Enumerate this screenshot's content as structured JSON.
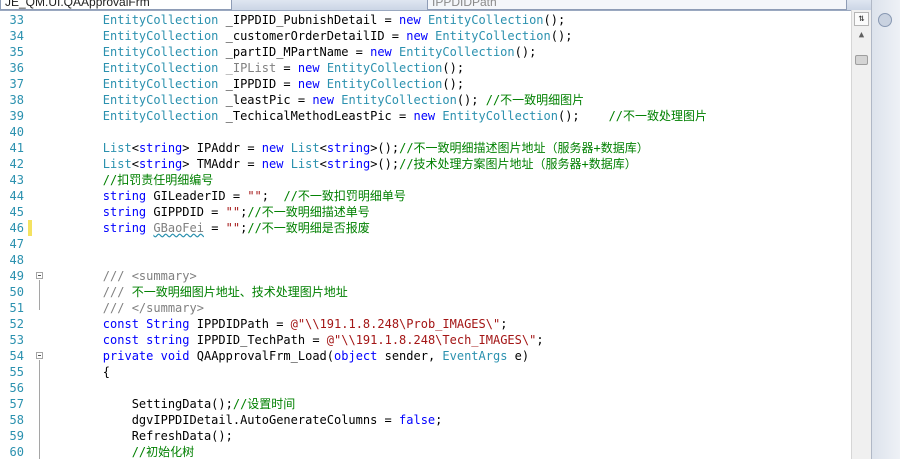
{
  "window": {
    "file_tab": "JE_QM.UI.QAApprovalFrm",
    "member_dropdown": "IPPDIDPath"
  },
  "editor": {
    "lines": [
      {
        "n": "33",
        "segs": [
          [
            "",
            "        "
          ],
          [
            "ty",
            "EntityCollection"
          ],
          [
            "",
            " _IPPDID_PubnishDetail = "
          ],
          [
            "kw",
            "new"
          ],
          [
            "",
            " "
          ],
          [
            "ty",
            "EntityCollection"
          ],
          [
            "",
            "();"
          ]
        ]
      },
      {
        "n": "34",
        "segs": [
          [
            "",
            "        "
          ],
          [
            "ty",
            "EntityCollection"
          ],
          [
            "",
            " _customerOrderDetailID = "
          ],
          [
            "kw",
            "new"
          ],
          [
            "",
            " "
          ],
          [
            "ty",
            "EntityCollection"
          ],
          [
            "",
            "();"
          ]
        ]
      },
      {
        "n": "35",
        "segs": [
          [
            "",
            "        "
          ],
          [
            "ty",
            "EntityCollection"
          ],
          [
            "",
            " _partID_MPartName = "
          ],
          [
            "kw",
            "new"
          ],
          [
            "",
            " "
          ],
          [
            "ty",
            "EntityCollection"
          ],
          [
            "",
            "();"
          ]
        ]
      },
      {
        "n": "36",
        "segs": [
          [
            "",
            "        "
          ],
          [
            "ty",
            "EntityCollection"
          ],
          [
            "",
            " "
          ],
          [
            "gray",
            "_IPList"
          ],
          [
            "",
            " = "
          ],
          [
            "kw",
            "new"
          ],
          [
            "",
            " "
          ],
          [
            "ty",
            "EntityCollection"
          ],
          [
            "",
            "();"
          ]
        ]
      },
      {
        "n": "37",
        "segs": [
          [
            "",
            "        "
          ],
          [
            "ty",
            "EntityCollection"
          ],
          [
            "",
            " _IPPDID = "
          ],
          [
            "kw",
            "new"
          ],
          [
            "",
            " "
          ],
          [
            "ty",
            "EntityCollection"
          ],
          [
            "",
            "();"
          ]
        ]
      },
      {
        "n": "38",
        "segs": [
          [
            "",
            "        "
          ],
          [
            "ty",
            "EntityCollection"
          ],
          [
            "",
            " _leastPic = "
          ],
          [
            "kw",
            "new"
          ],
          [
            "",
            " "
          ],
          [
            "ty",
            "EntityCollection"
          ],
          [
            "",
            "(); "
          ],
          [
            "cm",
            "//不一致明细图片"
          ]
        ]
      },
      {
        "n": "39",
        "segs": [
          [
            "",
            "        "
          ],
          [
            "ty",
            "EntityCollection"
          ],
          [
            "",
            " _TechicalMethodLeastPic = "
          ],
          [
            "kw",
            "new"
          ],
          [
            "",
            " "
          ],
          [
            "ty",
            "EntityCollection"
          ],
          [
            "",
            "();    "
          ],
          [
            "cm",
            "//不一致处理图片"
          ]
        ]
      },
      {
        "n": "40",
        "segs": []
      },
      {
        "n": "41",
        "segs": [
          [
            "",
            "        "
          ],
          [
            "ty",
            "List"
          ],
          [
            "",
            "<"
          ],
          [
            "kw",
            "string"
          ],
          [
            "",
            "> IPAddr = "
          ],
          [
            "kw",
            "new"
          ],
          [
            "",
            " "
          ],
          [
            "ty",
            "List"
          ],
          [
            "",
            "<"
          ],
          [
            "kw",
            "string"
          ],
          [
            "",
            ">();"
          ],
          [
            "cm",
            "//不一致明细描述图片地址（服务器+数据库）"
          ]
        ]
      },
      {
        "n": "42",
        "segs": [
          [
            "",
            "        "
          ],
          [
            "ty",
            "List"
          ],
          [
            "",
            "<"
          ],
          [
            "kw",
            "string"
          ],
          [
            "",
            "> TMAddr = "
          ],
          [
            "kw",
            "new"
          ],
          [
            "",
            " "
          ],
          [
            "ty",
            "List"
          ],
          [
            "",
            "<"
          ],
          [
            "kw",
            "string"
          ],
          [
            "",
            ">();"
          ],
          [
            "cm",
            "//技术处理方案图片地址（服务器+数据库）"
          ]
        ]
      },
      {
        "n": "43",
        "segs": [
          [
            "",
            "        "
          ],
          [
            "cm",
            "//扣罚责任明细编号"
          ]
        ]
      },
      {
        "n": "44",
        "segs": [
          [
            "",
            "        "
          ],
          [
            "kw",
            "string"
          ],
          [
            "",
            " GILeaderID = "
          ],
          [
            "str",
            "\"\""
          ],
          [
            "",
            ";  "
          ],
          [
            "cm",
            "//不一致扣罚明细单号"
          ]
        ]
      },
      {
        "n": "45",
        "segs": [
          [
            "",
            "        "
          ],
          [
            "kw",
            "string"
          ],
          [
            "",
            " GIPPDID = "
          ],
          [
            "str",
            "\"\""
          ],
          [
            "",
            ";"
          ],
          [
            "cm",
            "//不一致明细描述单号"
          ]
        ]
      },
      {
        "n": "46",
        "segs": [
          [
            "",
            "        "
          ],
          [
            "kw",
            "string"
          ],
          [
            "",
            " "
          ],
          [
            "gsq",
            "GBaoFei"
          ],
          [
            "",
            " = "
          ],
          [
            "str",
            "\"\""
          ],
          [
            "",
            ";"
          ],
          [
            "cm",
            "//不一致明细是否报废"
          ]
        ]
      },
      {
        "n": "47",
        "segs": []
      },
      {
        "n": "48",
        "segs": []
      },
      {
        "n": "49",
        "segs": [
          [
            "",
            "        "
          ],
          [
            "gray",
            "/// <summary>"
          ]
        ]
      },
      {
        "n": "50",
        "segs": [
          [
            "",
            "        "
          ],
          [
            "gray",
            "///"
          ],
          [
            "cm",
            " 不一致明细图片地址、技术处理图片地址"
          ]
        ]
      },
      {
        "n": "51",
        "segs": [
          [
            "",
            "        "
          ],
          [
            "gray",
            "/// </summary>"
          ]
        ]
      },
      {
        "n": "52",
        "segs": [
          [
            "",
            "        "
          ],
          [
            "kw",
            "const"
          ],
          [
            "",
            " "
          ],
          [
            "kw",
            "String"
          ],
          [
            "",
            " IPPDIDPath = "
          ],
          [
            "str",
            "@\"\\\\191.1.8.248\\Prob_IMAGES\\\""
          ],
          [
            "",
            ";"
          ]
        ]
      },
      {
        "n": "53",
        "segs": [
          [
            "",
            "        "
          ],
          [
            "kw",
            "const"
          ],
          [
            "",
            " "
          ],
          [
            "kw",
            "string"
          ],
          [
            "",
            " IPPDID_TechPath = "
          ],
          [
            "str",
            "@\"\\\\191.1.8.248\\Tech_IMAGES\\\""
          ],
          [
            "",
            ";"
          ]
        ]
      },
      {
        "n": "54",
        "segs": [
          [
            "",
            "        "
          ],
          [
            "kw",
            "private"
          ],
          [
            "",
            " "
          ],
          [
            "kw",
            "void"
          ],
          [
            "",
            " QAApprovalFrm_Load("
          ],
          [
            "kw",
            "object"
          ],
          [
            "",
            " sender, "
          ],
          [
            "ty",
            "EventArgs"
          ],
          [
            "",
            " e)"
          ]
        ]
      },
      {
        "n": "55",
        "segs": [
          [
            "",
            "        {"
          ]
        ]
      },
      {
        "n": "56",
        "segs": []
      },
      {
        "n": "57",
        "segs": [
          [
            "",
            "            SettingData();"
          ],
          [
            "cm",
            "//设置时间"
          ]
        ]
      },
      {
        "n": "58",
        "segs": [
          [
            "",
            "            dgvIPPDIDetail.AutoGenerateColumns = "
          ],
          [
            "kw",
            "false"
          ],
          [
            "",
            ";"
          ]
        ]
      },
      {
        "n": "59",
        "segs": [
          [
            "",
            "            RefreshData();"
          ]
        ]
      },
      {
        "n": "60",
        "segs": [
          [
            "",
            "            "
          ],
          [
            "cm",
            "//初始化树"
          ]
        ]
      }
    ]
  },
  "scrollbar": {
    "split_glyph": "⇅",
    "up_arrow": "▲"
  },
  "colors": {
    "keyword": "#0000ff",
    "type": "#2b91af",
    "string": "#a31515",
    "comment": "#008000",
    "line_number": "#2b91af",
    "change_marker": "#f4e261"
  }
}
